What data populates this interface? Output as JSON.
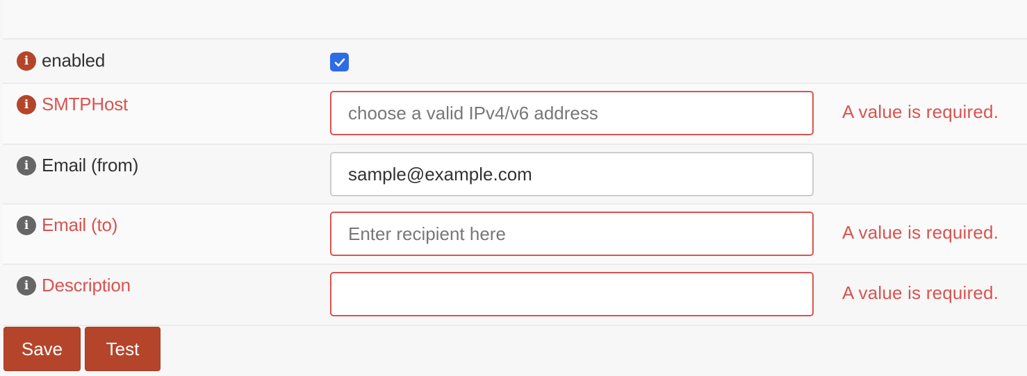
{
  "form": {
    "fields": [
      {
        "label": "enabled",
        "type": "checkbox",
        "checked": true,
        "error": false
      },
      {
        "label": "SMTPHost",
        "type": "text",
        "value": "",
        "placeholder": "choose a valid IPv4/v6 address",
        "error": true,
        "error_message": "A value is required."
      },
      {
        "label": "Email (from)",
        "type": "text",
        "value": "sample@example.com",
        "placeholder": "",
        "error": false
      },
      {
        "label": "Email (to)",
        "type": "text",
        "value": "",
        "placeholder": "Enter recipient here",
        "error": true,
        "error_message": "A value is required."
      },
      {
        "label": "Description",
        "type": "text",
        "value": "",
        "placeholder": "",
        "error": true,
        "error_message": "A value is required."
      }
    ],
    "info_icon_glyph": "i"
  },
  "actions": {
    "save_label": "Save",
    "test_label": "Test"
  },
  "colors": {
    "brand": "#b5452a",
    "error": "#d9534f",
    "checkbox": "#2e6be6",
    "info_grey": "#666666"
  },
  "icons": {
    "info": "info-circle-icon",
    "check": "checkmark-icon"
  }
}
